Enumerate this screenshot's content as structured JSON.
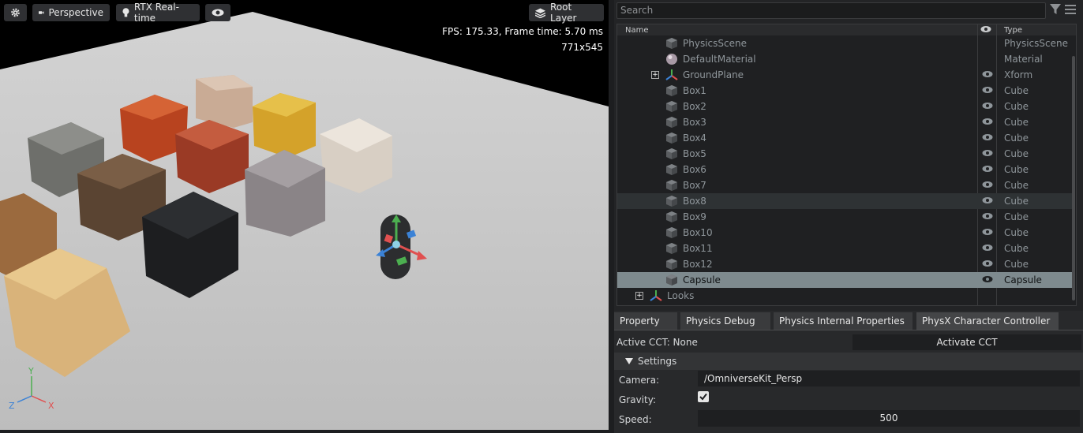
{
  "viewport": {
    "settings_icon": "gear-icon",
    "camera_button": {
      "icon": "camera-icon",
      "label": "Perspective"
    },
    "render_button": {
      "icon": "lightbulb-icon",
      "label": "RTX Real-time"
    },
    "visibility_icon": "eye-icon",
    "layer_button": {
      "icon": "layers-icon",
      "label": "Root Layer"
    },
    "fps_text": "FPS: 175.33, Frame time: 5.70 ms",
    "resolution_text": "771x545",
    "axis_labels": {
      "x": "X",
      "y": "Y",
      "z": "Z"
    }
  },
  "stage": {
    "search_placeholder": "Search",
    "columns": {
      "name": "Name",
      "type": "Type"
    },
    "rows": [
      {
        "name": "PhysicsScene",
        "type": "PhysicsScene",
        "icon": "cube-icon"
      },
      {
        "name": "DefaultMaterial",
        "type": "Material",
        "icon": "sphere-icon"
      },
      {
        "name": "GroundPlane",
        "type": "Xform",
        "icon": "xform-icon"
      },
      {
        "name": "Box1",
        "type": "Cube",
        "icon": "cube-icon"
      },
      {
        "name": "Box2",
        "type": "Cube",
        "icon": "cube-icon"
      },
      {
        "name": "Box3",
        "type": "Cube",
        "icon": "cube-icon"
      },
      {
        "name": "Box4",
        "type": "Cube",
        "icon": "cube-icon"
      },
      {
        "name": "Box5",
        "type": "Cube",
        "icon": "cube-icon"
      },
      {
        "name": "Box6",
        "type": "Cube",
        "icon": "cube-icon"
      },
      {
        "name": "Box7",
        "type": "Cube",
        "icon": "cube-icon"
      },
      {
        "name": "Box8",
        "type": "Cube",
        "icon": "cube-icon"
      },
      {
        "name": "Box9",
        "type": "Cube",
        "icon": "cube-icon"
      },
      {
        "name": "Box10",
        "type": "Cube",
        "icon": "cube-icon"
      },
      {
        "name": "Box11",
        "type": "Cube",
        "icon": "cube-icon"
      },
      {
        "name": "Box12",
        "type": "Cube",
        "icon": "cube-icon"
      },
      {
        "name": "Capsule",
        "type": "Capsule",
        "icon": "cube-icon"
      },
      {
        "name": "Looks",
        "type": "",
        "icon": "xform-icon"
      }
    ]
  },
  "properties": {
    "tabs": [
      "Property",
      "Physics Debug",
      "Physics Internal Properties",
      "PhysX Character Controller"
    ],
    "active_cct_label": "Active CCT: None",
    "activate_button": "Activate CCT",
    "settings_label": "Settings",
    "camera_label": "Camera:",
    "camera_value": "/OmniverseKit_Persp",
    "gravity_label": "Gravity:",
    "gravity_checked": true,
    "speed_label": "Speed:",
    "speed_value": "500"
  }
}
